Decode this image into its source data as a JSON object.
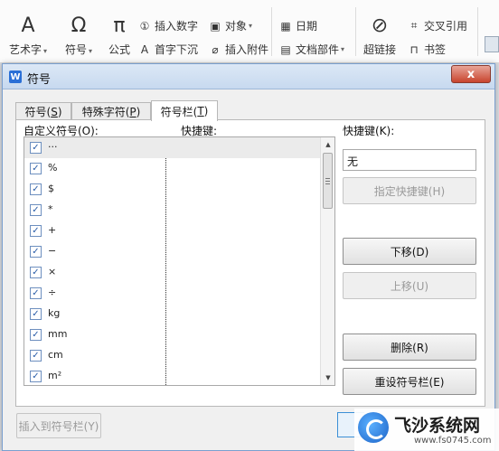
{
  "ribbon": {
    "art_text": "艺术字",
    "symbol": "符号",
    "formula": "公式",
    "insert_number": "插入数字",
    "drop_cap": "首字下沉",
    "object": "对象",
    "insert_attachment": "插入附件",
    "date": "日期",
    "doc_parts": "文档部件",
    "hyperlink": "超链接",
    "cross_reference": "交叉引用",
    "bookmark": "书签"
  },
  "dialog": {
    "title": "符号",
    "close_label": "x",
    "tabs": [
      {
        "label": "符号(",
        "key": "S",
        "suffix": ")"
      },
      {
        "label": "特殊字符(",
        "key": "P",
        "suffix": ")"
      },
      {
        "label": "符号栏(",
        "key": "T",
        "suffix": ")"
      }
    ],
    "custom_symbols_label": "自定义符号(O):",
    "shortcut_col_label": "快捷键:",
    "shortcut_label": "快捷键(K):",
    "shortcut_value": "无",
    "symbols": [
      "···",
      "%",
      "$",
      "*",
      "+",
      "−",
      "×",
      "÷",
      "kg",
      "mm",
      "cm",
      "m²"
    ],
    "buttons": {
      "assign_shortcut": "指定快捷键(H)",
      "move_down": "下移(D)",
      "move_up": "上移(U)",
      "delete": "删除(R)",
      "reset": "重设符号栏(E)",
      "insert_to_bar": "插入到符号栏(Y)"
    }
  },
  "watermark": {
    "title": "飞沙系统网",
    "url": "www.fs0745.com"
  }
}
